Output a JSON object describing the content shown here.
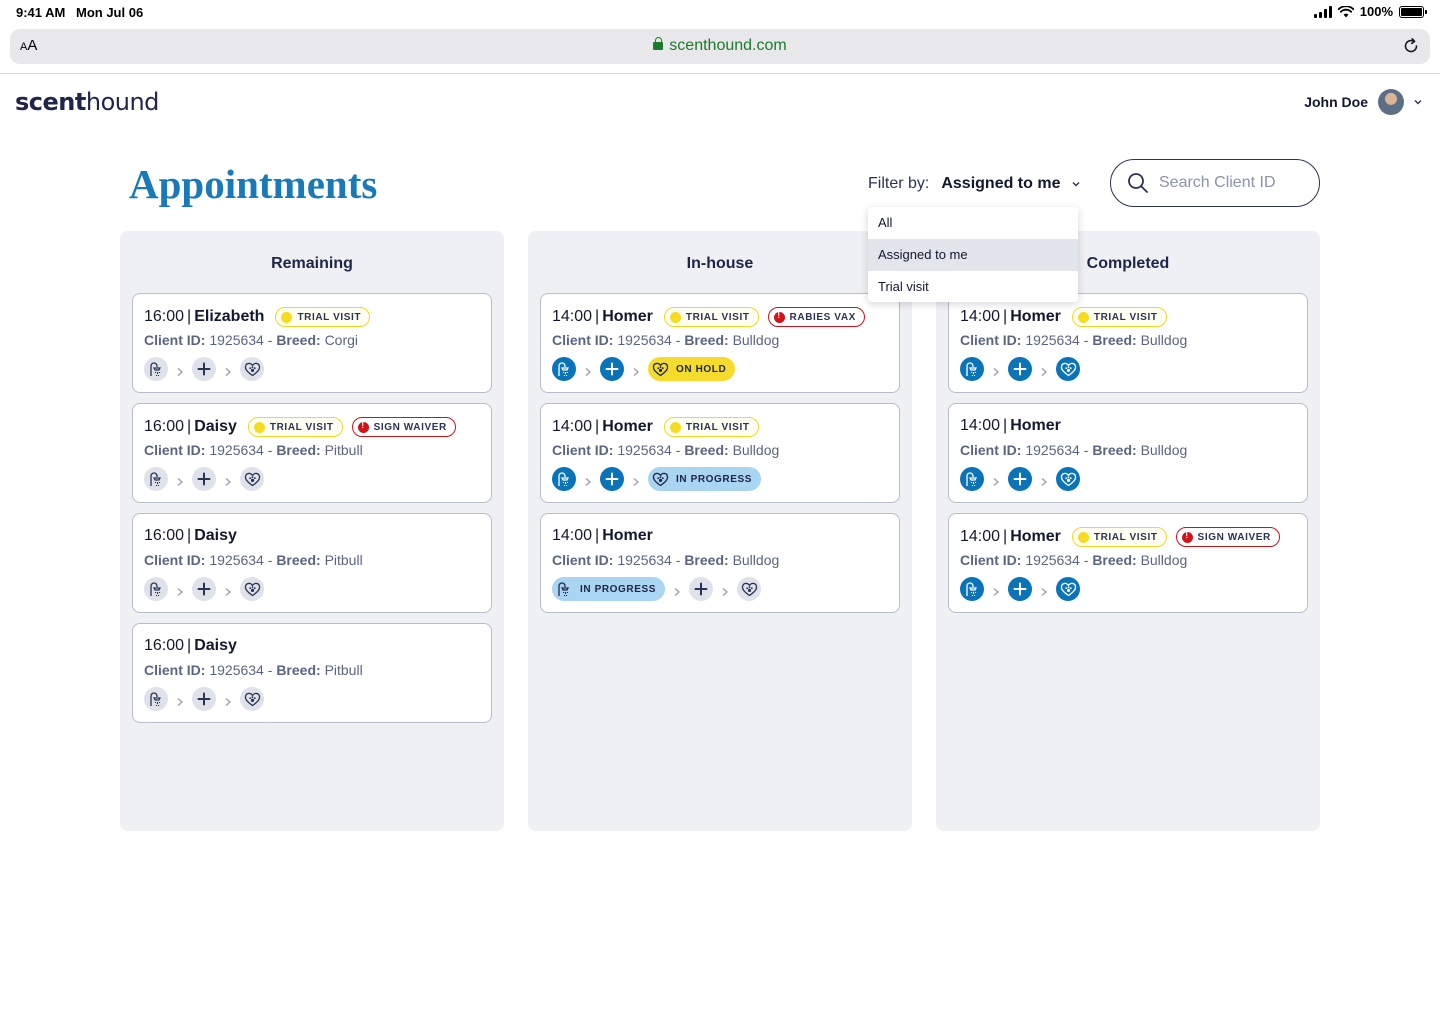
{
  "status_bar": {
    "time": "9:41 AM",
    "date": "Mon Jul 06",
    "battery": "100%"
  },
  "browser": {
    "text_size_label": "AA",
    "url": "scenthound.com"
  },
  "app": {
    "logo_bold": "scent",
    "logo_rest": "hound",
    "user_name": "John Doe"
  },
  "page": {
    "title": "Appointments",
    "filter_label": "Filter by:",
    "filter_value": "Assigned to me",
    "search_placeholder": "Search Client ID"
  },
  "filter_options": [
    {
      "label": "All",
      "selected": false
    },
    {
      "label": "Assigned to me",
      "selected": true
    },
    {
      "label": "Trial visit",
      "selected": false
    }
  ],
  "labels": {
    "client_id": "Client ID:",
    "breed": "Breed:",
    "sep": " - "
  },
  "icons": {
    "step1": "shower-icon",
    "step2": "plus-icon",
    "step3": "heart-paw-icon",
    "search": "search-icon",
    "chevron": "chevron-down-icon"
  },
  "colors": {
    "brand_blue": "#0b73b7",
    "title_blue": "#1a7ab8",
    "trial_yellow": "#f5dc1f",
    "alert_red": "#d0141a",
    "progress_blue": "#a9d4f2",
    "column_bg": "#eff0f4"
  },
  "columns": [
    {
      "title": "Remaining",
      "cards": [
        {
          "time": "16:00",
          "name": "Elizabeth",
          "client_id": "1925634",
          "breed": "Corgi",
          "badges": [
            {
              "type": "trial",
              "label": "TRIAL VISIT"
            }
          ],
          "steps": [
            "grey",
            "grey",
            "grey"
          ],
          "status": null
        },
        {
          "time": "16:00",
          "name": "Daisy",
          "client_id": "1925634",
          "breed": "Pitbull",
          "badges": [
            {
              "type": "trial",
              "label": "TRIAL VISIT"
            },
            {
              "type": "alert",
              "label": "SIGN WAIVER"
            }
          ],
          "steps": [
            "grey",
            "grey",
            "grey"
          ],
          "status": null
        },
        {
          "time": "16:00",
          "name": "Daisy",
          "client_id": "1925634",
          "breed": "Pitbull",
          "badges": [],
          "steps": [
            "grey",
            "grey",
            "grey"
          ],
          "status": null
        },
        {
          "time": "16:00",
          "name": "Daisy",
          "client_id": "1925634",
          "breed": "Pitbull",
          "badges": [],
          "steps": [
            "grey",
            "grey",
            "grey"
          ],
          "status": null
        }
      ]
    },
    {
      "title": "In-house",
      "cards": [
        {
          "time": "14:00",
          "name": "Homer",
          "client_id": "1925634",
          "breed": "Bulldog",
          "badges": [
            {
              "type": "trial",
              "label": "TRIAL VISIT"
            },
            {
              "type": "alert",
              "label": "RABIES VAX"
            }
          ],
          "steps": [
            "blue",
            "blue",
            "pill:hold"
          ],
          "status": "ON HOLD"
        },
        {
          "time": "14:00",
          "name": "Homer",
          "client_id": "1925634",
          "breed": "Bulldog",
          "badges": [
            {
              "type": "trial",
              "label": "TRIAL VISIT"
            }
          ],
          "steps": [
            "blue",
            "blue",
            "pill:progress"
          ],
          "status": "IN PROGRESS"
        },
        {
          "time": "14:00",
          "name": "Homer",
          "client_id": "1925634",
          "breed": "Bulldog",
          "badges": [],
          "steps": [
            "pill:progress",
            "grey",
            "grey"
          ],
          "status": "IN PROGRESS"
        }
      ]
    },
    {
      "title": "Completed",
      "cards": [
        {
          "time": "14:00",
          "name": "Homer",
          "client_id": "1925634",
          "breed": "Bulldog",
          "badges": [
            {
              "type": "trial",
              "label": "TRIAL VISIT"
            }
          ],
          "steps": [
            "blue",
            "blue",
            "blue"
          ],
          "status": null
        },
        {
          "time": "14:00",
          "name": "Homer",
          "client_id": "1925634",
          "breed": "Bulldog",
          "badges": [],
          "steps": [
            "blue",
            "blue",
            "blue"
          ],
          "status": null
        },
        {
          "time": "14:00",
          "name": "Homer",
          "client_id": "1925634",
          "breed": "Bulldog",
          "badges": [
            {
              "type": "trial",
              "label": "TRIAL VISIT"
            },
            {
              "type": "alert",
              "label": "SIGN WAIVER"
            }
          ],
          "steps": [
            "blue",
            "blue",
            "blue"
          ],
          "status": null
        }
      ]
    }
  ]
}
